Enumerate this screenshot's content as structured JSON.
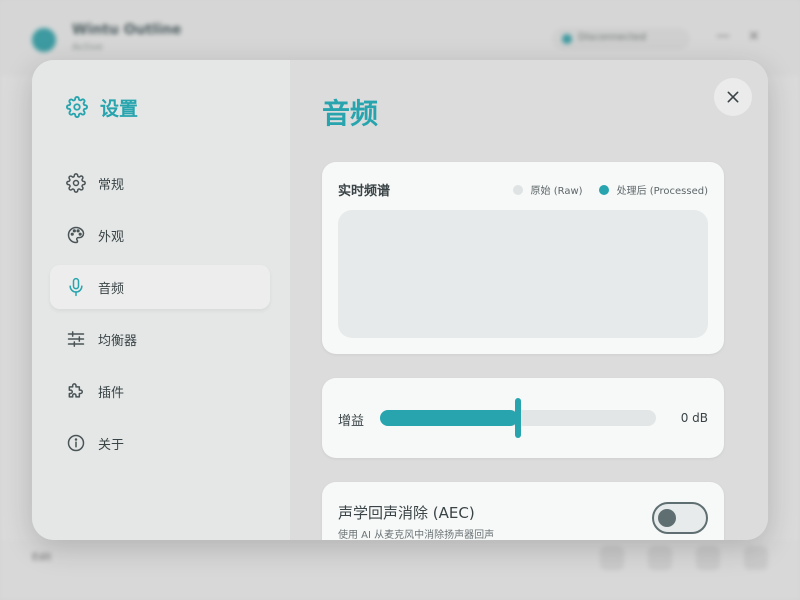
{
  "background_app": {
    "title": "Wintu Outline",
    "subtitle": "Active",
    "status": "Disconnected",
    "footer_label": "Edit"
  },
  "sidebar": {
    "title": "设置",
    "items": [
      {
        "label": "常规",
        "icon": "gear-icon"
      },
      {
        "label": "外观",
        "icon": "palette-icon"
      },
      {
        "label": "音频",
        "icon": "microphone-icon",
        "active": true
      },
      {
        "label": "均衡器",
        "icon": "sliders-icon"
      },
      {
        "label": "插件",
        "icon": "puzzle-icon"
      },
      {
        "label": "关于",
        "icon": "info-icon"
      }
    ]
  },
  "main": {
    "title": "音频",
    "spectrum": {
      "title": "实时频谱",
      "legend_raw": "原始 (Raw)",
      "legend_processed": "处理后 (Processed)"
    },
    "gain": {
      "label": "增益",
      "value_text": "0 dB",
      "level_percent": 50
    },
    "aec": {
      "title": "声学回声消除 (AEC)",
      "description": "使用 AI 从麦克风中消除扬声器回声",
      "enabled": false
    }
  },
  "colors": {
    "accent": "#27a4ae",
    "legend_raw": "#dfe3e3",
    "toggle_off": "#5f6f71"
  }
}
